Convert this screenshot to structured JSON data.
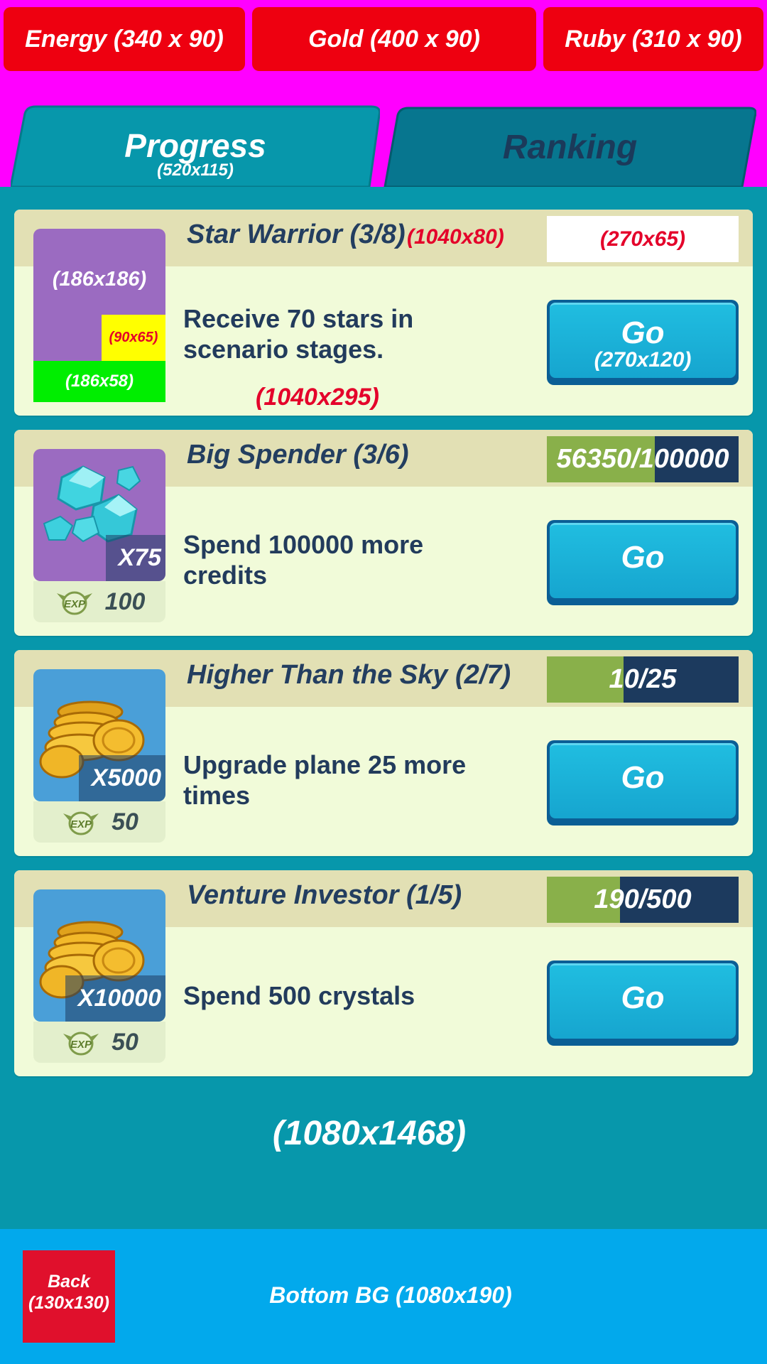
{
  "resources": {
    "energy": "Energy (340 x 90)",
    "gold": "Gold (400 x 90)",
    "ruby": "Ruby (310 x 90)"
  },
  "tabs": {
    "progress": {
      "label": "Progress",
      "size_note": "(520x115)"
    },
    "ranking": {
      "label": "Ranking"
    }
  },
  "annotations": {
    "header_size": "(1040x80)",
    "progress_box_size": "(270x65)",
    "icon_size": "(186x186)",
    "qty_size": "(90x65)",
    "exp_size": "(186x58)",
    "card_size": "(1040x295)",
    "button_size": "(270x120)",
    "panel_size": "(1080x1468)",
    "bottom_label": "Bottom BG (1080x190)"
  },
  "quests": [
    {
      "title": "Star Warrior (3/8)",
      "description": "Receive 70 stars in scenario stages.",
      "button": "Go"
    },
    {
      "title": "Big Spender (3/6)",
      "description": "Spend 100000 more credits",
      "reward_icon": "crystal-icon",
      "reward_qty": "X75",
      "exp": "100",
      "progress_text": "56350/100000",
      "progress_fraction": 0.5635,
      "button": "Go"
    },
    {
      "title": "Higher Than the Sky (2/7)",
      "description": "Upgrade plane 25 more times",
      "reward_icon": "gold-coins-icon",
      "reward_qty": "X5000",
      "exp": "50",
      "progress_text": "10/25",
      "progress_fraction": 0.4,
      "button": "Go"
    },
    {
      "title": "Venture Investor (1/5)",
      "description": "Spend 500 crystals",
      "reward_icon": "gold-coins-icon",
      "reward_qty": "X10000",
      "exp": "50",
      "progress_text": "190/500",
      "progress_fraction": 0.38,
      "button": "Go"
    }
  ],
  "exp_icon": "exp-wings-icon",
  "back": {
    "label": "Back",
    "size_note": "(130x130)"
  },
  "colors": {
    "top_bg": "#ff00ff",
    "resource_btn": "#ee0010",
    "panel_bg": "#0797ab",
    "bottom_bg": "#02a9ec",
    "progress_fill": "#89b04a",
    "progress_bg": "#1c3a5e"
  }
}
